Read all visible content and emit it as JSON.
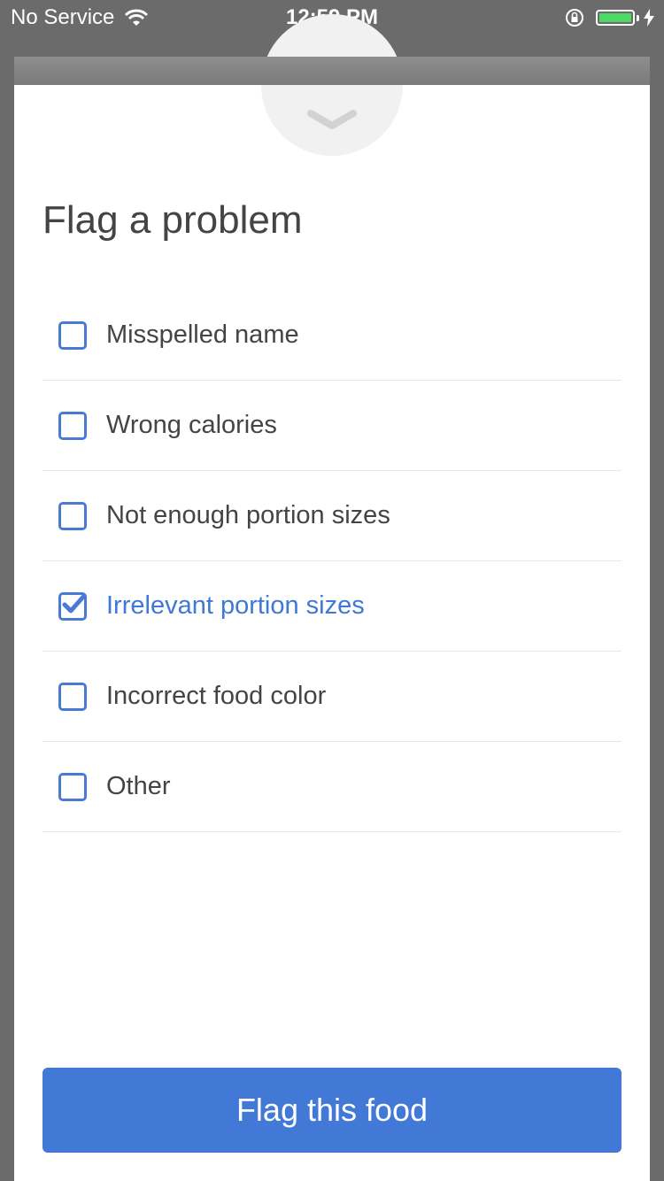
{
  "status_bar": {
    "carrier": "No Service",
    "time": "12:59 PM",
    "battery_level": 1.0,
    "battery_color": "#4cd964",
    "icons": [
      "wifi-icon",
      "lock-rotation-icon",
      "battery-icon",
      "charging-bolt-icon"
    ]
  },
  "sheet": {
    "handle_icon": "chevron-down-icon",
    "title": "Flag a problem",
    "options": [
      {
        "label": "Misspelled name",
        "checked": false
      },
      {
        "label": "Wrong calories",
        "checked": false
      },
      {
        "label": "Not enough portion sizes",
        "checked": false
      },
      {
        "label": "Irrelevant portion sizes",
        "checked": true
      },
      {
        "label": "Incorrect food color",
        "checked": false
      },
      {
        "label": "Other",
        "checked": false
      }
    ],
    "button_label": "Flag this food"
  },
  "colors": {
    "accent": "#4279d6",
    "text": "#444444",
    "divider": "#e6e6e6"
  }
}
